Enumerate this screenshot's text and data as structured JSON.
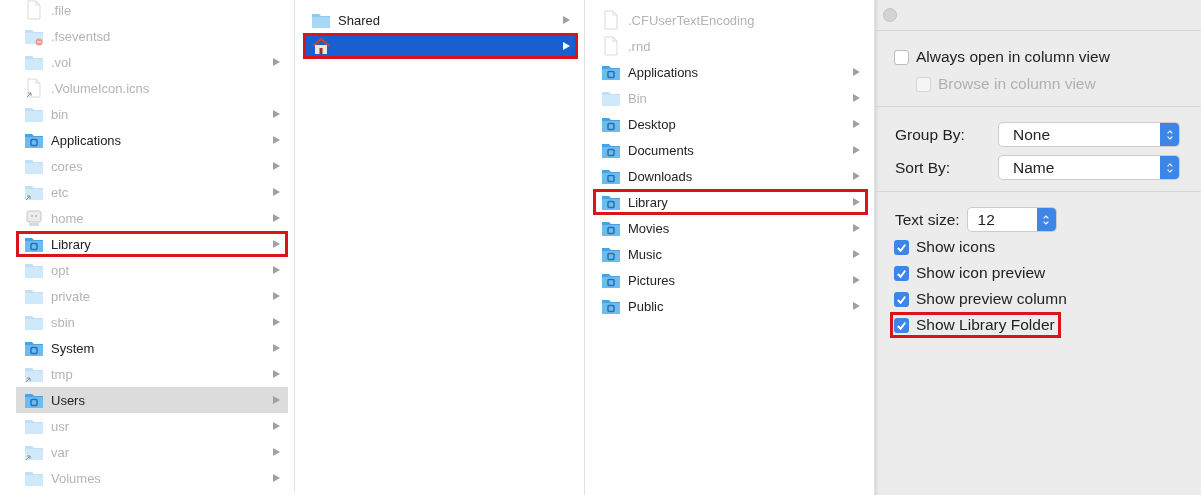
{
  "columns": [
    {
      "rows": [
        {
          "name": ".file",
          "kind": "file",
          "dimmed": true,
          "arrow": false,
          "selected": false,
          "highlighted": false
        },
        {
          "name": ".fseventsd",
          "kind": "badged",
          "dimmed": true,
          "arrow": false,
          "selected": false,
          "highlighted": false
        },
        {
          "name": ".vol",
          "kind": "folder",
          "dimmed": true,
          "arrow": true,
          "selected": false,
          "highlighted": false
        },
        {
          "name": ".VolumeIcon.icns",
          "kind": "link",
          "dimmed": true,
          "arrow": false,
          "selected": false,
          "highlighted": false
        },
        {
          "name": "bin",
          "kind": "folder",
          "dimmed": true,
          "arrow": true,
          "selected": false,
          "highlighted": false
        },
        {
          "name": "Applications",
          "kind": "special",
          "dimmed": false,
          "arrow": true,
          "selected": false,
          "highlighted": false
        },
        {
          "name": "cores",
          "kind": "folder",
          "dimmed": true,
          "arrow": true,
          "selected": false,
          "highlighted": false
        },
        {
          "name": "etc",
          "kind": "alias",
          "dimmed": true,
          "arrow": true,
          "selected": false,
          "highlighted": false
        },
        {
          "name": "home",
          "kind": "drive",
          "dimmed": true,
          "arrow": true,
          "selected": false,
          "highlighted": false
        },
        {
          "name": "Library",
          "kind": "special",
          "dimmed": false,
          "arrow": true,
          "selected": false,
          "highlighted": true
        },
        {
          "name": "opt",
          "kind": "folder",
          "dimmed": true,
          "arrow": true,
          "selected": false,
          "highlighted": false
        },
        {
          "name": "private",
          "kind": "folder",
          "dimmed": true,
          "arrow": true,
          "selected": false,
          "highlighted": false
        },
        {
          "name": "sbin",
          "kind": "folder",
          "dimmed": true,
          "arrow": true,
          "selected": false,
          "highlighted": false
        },
        {
          "name": "System",
          "kind": "special",
          "dimmed": false,
          "arrow": true,
          "selected": false,
          "highlighted": false
        },
        {
          "name": "tmp",
          "kind": "alias",
          "dimmed": true,
          "arrow": true,
          "selected": false,
          "highlighted": false
        },
        {
          "name": "Users",
          "kind": "special",
          "dimmed": false,
          "arrow": true,
          "selected": true,
          "highlighted": false
        },
        {
          "name": "usr",
          "kind": "folder",
          "dimmed": true,
          "arrow": true,
          "selected": false,
          "highlighted": false
        },
        {
          "name": "var",
          "kind": "alias",
          "dimmed": true,
          "arrow": true,
          "selected": false,
          "highlighted": false
        },
        {
          "name": "Volumes",
          "kind": "folder",
          "dimmed": true,
          "arrow": true,
          "selected": false,
          "highlighted": false
        }
      ]
    },
    {
      "rows": [
        {
          "name": "Shared",
          "kind": "folder",
          "dimmed": false,
          "arrow": true,
          "selected": false,
          "highlighted": false
        },
        {
          "kind": "house",
          "dimmed": false,
          "arrow": true,
          "selected": true,
          "highlighted": true
        }
      ]
    },
    {
      "rows": [
        {
          "name": ".CFUserTextEncoding",
          "kind": "file",
          "dimmed": true,
          "arrow": false,
          "selected": false,
          "highlighted": false
        },
        {
          "name": ".rnd",
          "kind": "file",
          "dimmed": true,
          "arrow": false,
          "selected": false,
          "highlighted": false
        },
        {
          "name": "Applications",
          "kind": "special",
          "dimmed": false,
          "arrow": true,
          "selected": false,
          "highlighted": false
        },
        {
          "name": "Bin",
          "kind": "folder",
          "dimmed": true,
          "arrow": true,
          "selected": false,
          "highlighted": false
        },
        {
          "name": "Desktop",
          "kind": "special",
          "dimmed": false,
          "arrow": true,
          "selected": false,
          "highlighted": false
        },
        {
          "name": "Documents",
          "kind": "special",
          "dimmed": false,
          "arrow": true,
          "selected": false,
          "highlighted": false
        },
        {
          "name": "Downloads",
          "kind": "special",
          "dimmed": false,
          "arrow": true,
          "selected": false,
          "highlighted": false
        },
        {
          "name": "Library",
          "kind": "special",
          "dimmed": false,
          "arrow": true,
          "selected": false,
          "highlighted": true
        },
        {
          "name": "Movies",
          "kind": "special",
          "dimmed": false,
          "arrow": true,
          "selected": false,
          "highlighted": false
        },
        {
          "name": "Music",
          "kind": "special",
          "dimmed": false,
          "arrow": true,
          "selected": false,
          "highlighted": false
        },
        {
          "name": "Pictures",
          "kind": "special",
          "dimmed": false,
          "arrow": true,
          "selected": false,
          "highlighted": false
        },
        {
          "name": "Public",
          "kind": "special",
          "dimmed": false,
          "arrow": true,
          "selected": false,
          "highlighted": false
        }
      ]
    }
  ],
  "view_options": {
    "sections": [
      [
        {
          "kind": "checkbox",
          "label": "Always open in column view",
          "checked": false,
          "disabled": false,
          "highlighted": false,
          "children": [
            {
              "kind": "checkbox",
              "label": "Browse in column view",
              "checked": false,
              "disabled": true,
              "highlighted": false
            }
          ]
        }
      ],
      [
        {
          "kind": "popup",
          "label": "Group By:",
          "value": "None"
        },
        {
          "kind": "popup",
          "label": "Sort By:",
          "value": "Name"
        }
      ],
      [
        {
          "kind": "stepper",
          "label": "Text size:",
          "value": "12"
        },
        {
          "kind": "checkbox",
          "label": "Show icons",
          "checked": true,
          "disabled": false,
          "highlighted": false
        },
        {
          "kind": "checkbox",
          "label": "Show icon preview",
          "checked": true,
          "disabled": false,
          "highlighted": false
        },
        {
          "kind": "checkbox",
          "label": "Show preview column",
          "checked": true,
          "disabled": false,
          "highlighted": false
        },
        {
          "kind": "checkbox",
          "label": "Show Library Folder",
          "checked": true,
          "disabled": false,
          "highlighted": true
        }
      ]
    ]
  }
}
